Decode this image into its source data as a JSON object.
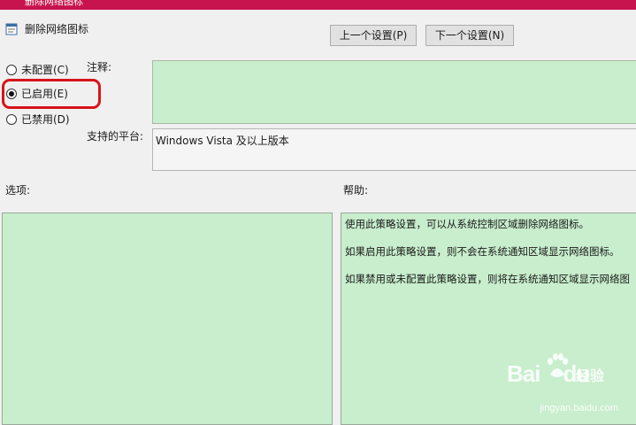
{
  "window": {
    "title": "删除网络图标"
  },
  "header": {
    "policy_title": "删除网络图标",
    "prev_button": "上一个设置(P)",
    "next_button": "下一个设置(N)"
  },
  "state_options": [
    {
      "label": "未配置(C)",
      "checked": false
    },
    {
      "label": "已启用(E)",
      "checked": true
    },
    {
      "label": "已禁用(D)",
      "checked": false
    }
  ],
  "comment": {
    "label": "注释:",
    "value": ""
  },
  "platform": {
    "label": "支持的平台:",
    "value": "Windows Vista 及以上版本"
  },
  "options": {
    "label": "选项:"
  },
  "help": {
    "label": "帮助:",
    "paragraphs": [
      "使用此策略设置，可以从系统控制区域删除网络图标。",
      "如果启用此策略设置，则不会在系统通知区域显示网络图标。",
      "如果禁用或未配置此策略设置，则将在系统通知区域显示网络图"
    ]
  },
  "watermark": {
    "brand": "Bai",
    "brand_tail": "du",
    "product": "经验",
    "url": "jingyan.baidu.com"
  },
  "colors": {
    "titlebar": "#c8144e",
    "panel_green": "#c8eecd",
    "highlight": "#d7141a"
  }
}
